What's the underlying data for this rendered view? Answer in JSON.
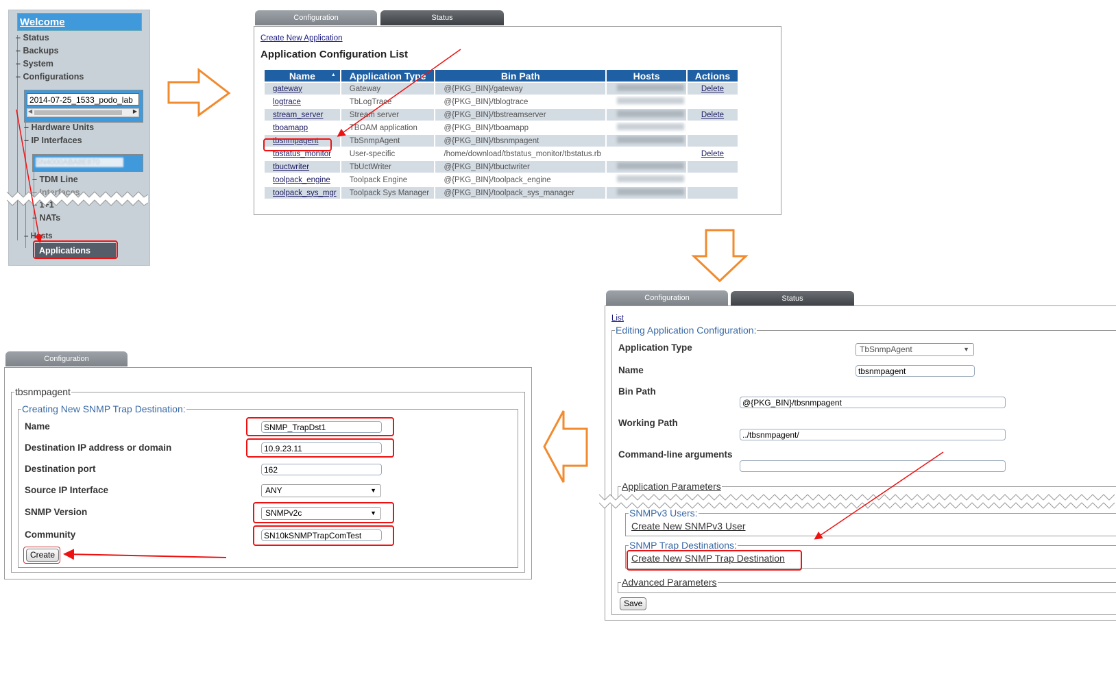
{
  "sidebar": {
    "welcome": "Welcome",
    "items": [
      "Status",
      "Backups",
      "System",
      "Configurations"
    ],
    "config_name": "2014-07-25_1533_podo_lab",
    "sub_items": [
      "Hardware Units",
      "IP Interfaces"
    ],
    "host_name": "SN4000ABA8E870",
    "host_items": [
      "TDM Line",
      "Interfaces",
      "1+1",
      "NATs"
    ],
    "hosts_label": "Hosts",
    "applications": "Applications"
  },
  "panel_list": {
    "tabs": [
      "Configuration",
      "Status"
    ],
    "create_link": "Create New Application",
    "title": "Application Configuration List",
    "columns": [
      "Name",
      "Application Type",
      "Bin Path",
      "Hosts",
      "Actions"
    ],
    "rows": [
      {
        "name": "gateway",
        "type": "Gateway",
        "bin": "@{PKG_BIN}/gateway",
        "host": "SN4000ABA8E870",
        "action": "Delete"
      },
      {
        "name": "logtrace",
        "type": "TbLogTrace",
        "bin": "@{PKG_BIN}/tblogtrace",
        "host": "SN4000ABA8E870",
        "action": ""
      },
      {
        "name": "stream_server",
        "type": "Stream server",
        "bin": "@{PKG_BIN}/tbstreamserver",
        "host": "SN4000ABA8E870",
        "action": "Delete"
      },
      {
        "name": "tboamapp",
        "type": "TBOAM application",
        "bin": "@{PKG_BIN}/tboamapp",
        "host": "SN4000ABA8E870",
        "action": ""
      },
      {
        "name": "tbsnmpagent",
        "type": "TbSnmpAgent",
        "bin": "@{PKG_BIN}/tbsnmpagent",
        "host": "SN4000ABA8E870",
        "action": ""
      },
      {
        "name": "tbstatus_monitor",
        "type": "User-specific",
        "bin": "/home/download/tbstatus_monitor/tbstatus.rb",
        "host": "",
        "action": "Delete"
      },
      {
        "name": "tbuctwriter",
        "type": "TbUctWriter",
        "bin": "@{PKG_BIN}/tbuctwriter",
        "host": "SN4000ABA8E870",
        "action": ""
      },
      {
        "name": "toolpack_engine",
        "type": "Toolpack Engine",
        "bin": "@{PKG_BIN}/toolpack_engine",
        "host": "SN4000ABA8E870",
        "action": ""
      },
      {
        "name": "toolpack_sys_mgr",
        "type": "Toolpack Sys Manager",
        "bin": "@{PKG_BIN}/toolpack_sys_manager",
        "host": "SN4000ABA8E870",
        "action": ""
      }
    ]
  },
  "panel_edit": {
    "tabs": [
      "Configuration",
      "Status"
    ],
    "list_link": "List",
    "legend": "Editing Application Configuration:",
    "labels": {
      "app_type": "Application Type",
      "name": "Name",
      "bin_path": "Bin Path",
      "working_path": "Working Path",
      "cmd_args": "Command-line arguments"
    },
    "values": {
      "app_type": "TbSnmpAgent",
      "name": "tbsnmpagent",
      "bin_path": "@{PKG_BIN}/tbsnmpagent",
      "working_path": "../tbsnmpagent/",
      "cmd_args": ""
    },
    "app_params": "Application Parameters",
    "snmpv3_users": "SNMPv3 Users:",
    "create_snmpv3_user": "Create New SNMPv3 User",
    "trap_destinations": "SNMP Trap Destinations:",
    "create_trap_dest": "Create New SNMP Trap Destination",
    "advanced": "Advanced Parameters",
    "save": "Save"
  },
  "panel_trap": {
    "tab": "Configuration",
    "outer_legend": "tbsnmpagent",
    "legend": "Creating New SNMP Trap Destination:",
    "labels": {
      "name": "Name",
      "dest_ip": "Destination IP address or domain",
      "dest_port": "Destination port",
      "source_if": "Source IP Interface",
      "snmp_version": "SNMP Version",
      "community": "Community"
    },
    "values": {
      "name": "SNMP_TrapDst1",
      "dest_ip": "10.9.23.11",
      "dest_port": "162",
      "source_if": "ANY",
      "snmp_version": "SNMPv2c",
      "community": "SN10kSNMPTrapComTest"
    },
    "create": "Create"
  },
  "colors": {
    "accent": "#1f5fa3",
    "highlight": "#e11111",
    "flow_arrow": "#f28a2e"
  }
}
